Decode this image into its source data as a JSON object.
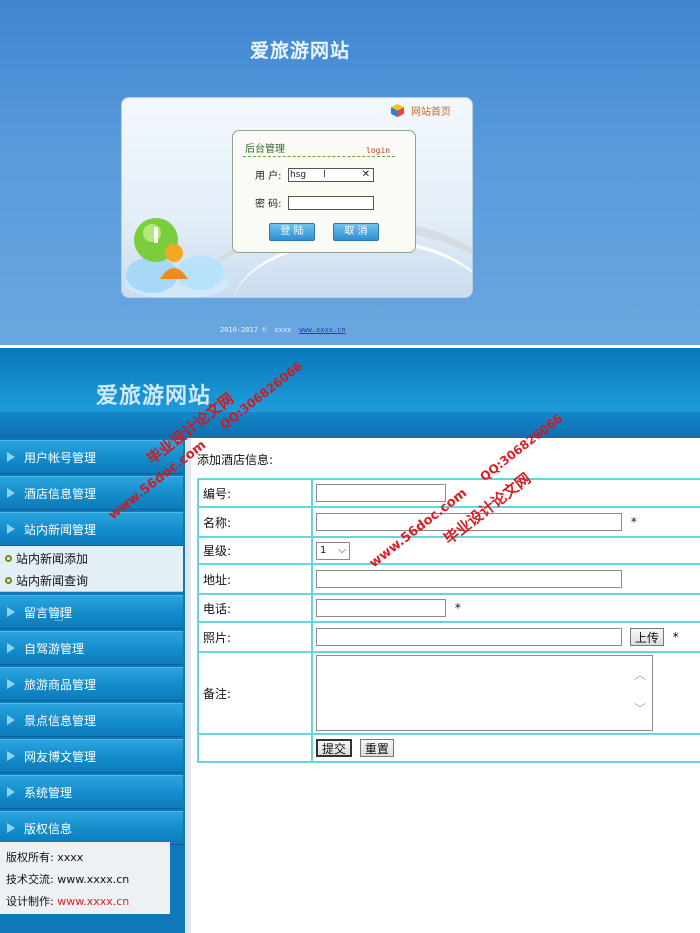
{
  "login": {
    "site_title": "爱旅游网站",
    "home_link": "网站首页",
    "box_title": "后台管理",
    "box_subtitle": "login",
    "username_label": "用  户:",
    "username_value": "hsg",
    "password_label": "密  码:",
    "password_value": "",
    "login_button": "登 陆",
    "cancel_button": "取 消",
    "footer_year": "2010-2017 ©",
    "footer_owner": "xxxx",
    "footer_link": "www.xxxx.cn"
  },
  "admin": {
    "site_title": "爱旅游网站",
    "sidebar": {
      "items": [
        {
          "label": "用户帐号管理"
        },
        {
          "label": "酒店信息管理"
        },
        {
          "label": "站内新闻管理"
        },
        {
          "label": "留言管理"
        },
        {
          "label": "自驾游管理"
        },
        {
          "label": "旅游商品管理"
        },
        {
          "label": "景点信息管理"
        },
        {
          "label": "网友博文管理"
        },
        {
          "label": "系统管理"
        },
        {
          "label": "版权信息"
        }
      ],
      "sub_items": [
        {
          "label": "站内新闻添加"
        },
        {
          "label": "站内新闻查询"
        }
      ],
      "info": {
        "copyright_label": "版权所有:",
        "copyright_value": "xxxx",
        "tech_label": "技术交流:",
        "tech_value": "www.xxxx.cn",
        "design_label": "设计制作:",
        "design_value": "www.xxxx.cn"
      }
    },
    "form": {
      "heading": "添加酒店信息:",
      "fields": {
        "code_label": "编号:",
        "name_label": "名称:",
        "star_label": "星级:",
        "star_value": "1",
        "address_label": "地址:",
        "phone_label": "电话:",
        "photo_label": "照片:",
        "upload_button": "上传",
        "remark_label": "备注:",
        "required_mark": "*"
      },
      "submit_button": "提交",
      "reset_button": "重置"
    },
    "watermarks": {
      "brand": "毕业设计论文网",
      "site": "www.56doc.com",
      "qq": "QQ:306826066"
    }
  }
}
